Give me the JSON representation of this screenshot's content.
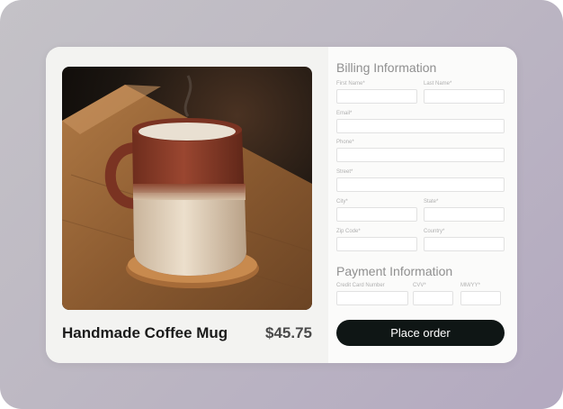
{
  "product": {
    "name": "Handmade Coffee Mug",
    "price": "$45.75"
  },
  "billing": {
    "title": "Billing Information",
    "fields": {
      "first_name": "First Name*",
      "last_name": "Last Name*",
      "email": "Email*",
      "phone": "Phone*",
      "street": "Street*",
      "city": "City*",
      "state": "State*",
      "zip": "Zip Code*",
      "country": "Country*"
    }
  },
  "payment": {
    "title": "Payment Information",
    "fields": {
      "card_number": "Credit Card Number",
      "cvv": "CVV*",
      "expiry": "MM/YY*"
    }
  },
  "actions": {
    "place_order": "Place order"
  },
  "colors": {
    "button_bg": "#0f1615",
    "mug_glaze": "#8a3b27",
    "mug_base": "#e3d3bd"
  }
}
